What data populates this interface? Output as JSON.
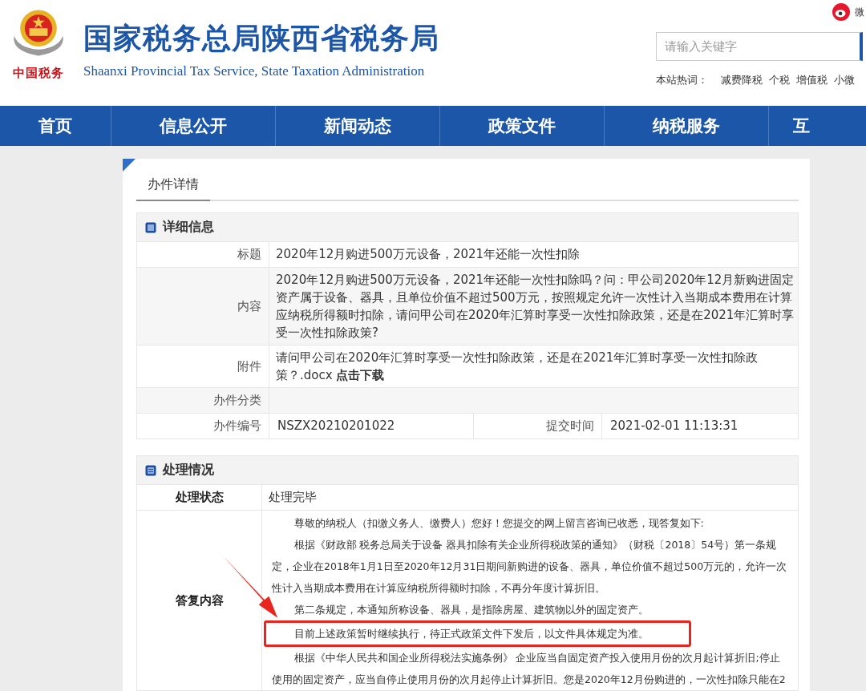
{
  "header": {
    "logo_caption": "中国税务",
    "title": "国家税务总局陕西省税务局",
    "subtitle": "Shaanxi Provincial Tax Service, State Taxation Administration",
    "weibo_label": "微",
    "search": {
      "placeholder": "请输入关键字"
    },
    "hot_words_label": "本站热词：",
    "hot_words": [
      "减费降税",
      "个税",
      "增值税",
      "小微"
    ]
  },
  "nav": [
    "首页",
    "信息公开",
    "新闻动态",
    "政策文件",
    "纳税服务",
    "互"
  ],
  "tabs": [
    {
      "label": "办件详情",
      "selected": true
    }
  ],
  "details": {
    "title": "详细信息",
    "rows": [
      {
        "label": "标题",
        "value": "2020年12月购进500万元设备，2021年还能一次性扣除"
      },
      {
        "label": "内容",
        "value": "2020年12月购进500万元设备，2021年还能一次性扣除吗？问：甲公司2020年12月新购进固定资产属于设备、器具，且单位价值不超过500万元，按照规定允许一次性计入当期成本费用在计算应纳税所得额时扣除，请问甲公司在2020年汇算时享受一次性扣除政策，还是在2021年汇算时享受一次性扣除政策?"
      },
      {
        "label": "附件",
        "value": "请问甲公司在2020年汇算时享受一次性扣除政策，还是在2021年汇算时享受一次性扣除政策？.docx",
        "link": "点击下载"
      },
      {
        "label": "办件分类",
        "value": ""
      }
    ],
    "number_label": "办件编号",
    "number": "NSZX20210201022",
    "time_label": "提交时间",
    "time": "2021-02-01 11:13:31"
  },
  "processing": {
    "title": "处理情况",
    "status_label": "处理状态",
    "status": "处理完毕",
    "reply_label": "答复内容",
    "paragraphs": [
      {
        "kind": "normal",
        "text": "尊敬的纳税人（扣缴义务人、缴费人）您好！您提交的网上留言咨询已收悉，现答复如下:"
      },
      {
        "kind": "normal",
        "text": "根据《财政部 税务总局关于设备 器具扣除有关企业所得税政策的通知》（财税〔2018〕54号）第一条规定，企业在2018年1月1日至2020年12月31日期间新购进的设备、器具，单位价值不超过500万元的，允许一次性计入当期成本费用在计算应纳税所得额时扣除，不再分年度计算折旧。"
      },
      {
        "kind": "normal",
        "text": "第二条规定，本通知所称设备、器具，是指除房屋、建筑物以外的固定资产。"
      },
      {
        "kind": "highlighted",
        "text": "目前上述政策暂时继续执行，待正式政策文件下发后，以文件具体规定为准。"
      },
      {
        "kind": "normal",
        "text": "根据《中华人民共和国企业所得税法实施条例》 企业应当自固定资产投入使用月份的次月起计算折旧;停止使用的固定资产，应当自停止使用月份的次月起停止计算折旧。您是2020年12月份购进的，一次性扣除只能在2"
      }
    ]
  }
}
